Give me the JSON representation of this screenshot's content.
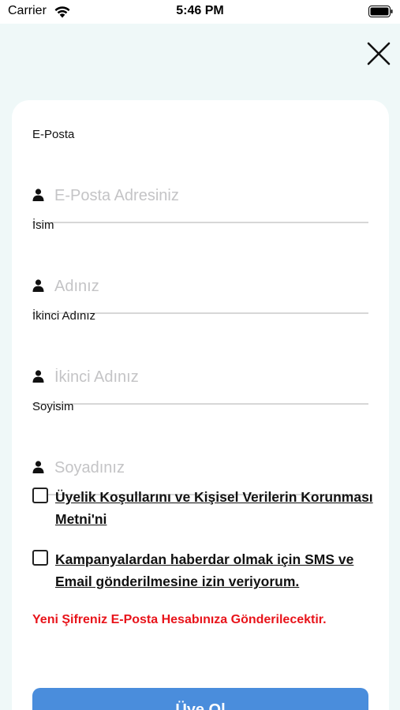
{
  "status_bar": {
    "carrier": "Carrier",
    "time": "5:46 PM",
    "icons": [
      "wifi-icon",
      "battery-icon"
    ]
  },
  "header": {
    "close_icon": "close-icon"
  },
  "form": {
    "fields": [
      {
        "label": "E-Posta",
        "placeholder": "E-Posta Adresiniz",
        "value": "",
        "icon": "user-icon"
      },
      {
        "label": "İsim",
        "placeholder": "Adınız",
        "value": "",
        "icon": "user-icon"
      },
      {
        "label": "İkinci Adınız",
        "placeholder": "İkinci Adınız",
        "value": "",
        "icon": "user-icon"
      },
      {
        "label": "Soyisim",
        "placeholder": "Soyadınız",
        "value": "",
        "icon": "user-icon"
      }
    ],
    "consents": [
      {
        "text": "Üyelik Koşullarını ve Kişisel Verilerin Korunması Metni'ni",
        "checked": false
      },
      {
        "text": "Kampanyalardan haberdar olmak için SMS ve Email gönderilmesine izin veriyorum.",
        "checked": false
      }
    ],
    "notice": "Yeni Şifreniz E-Posta Hesabınıza Gönderilecektir.",
    "submit_label": "Üye Ol"
  },
  "colors": {
    "background": "#eff8f8",
    "card": "#ffffff",
    "notice": "#e8141b",
    "button": "#4a8ddc"
  }
}
